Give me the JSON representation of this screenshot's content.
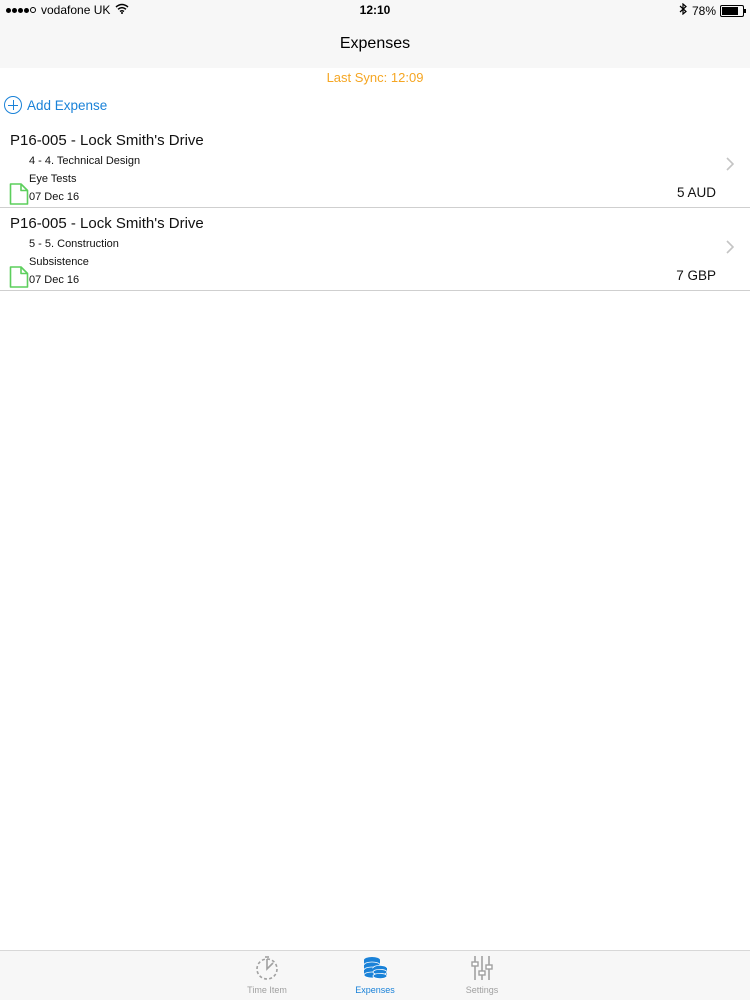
{
  "status_bar": {
    "carrier": "vodafone UK",
    "time": "12:10",
    "battery": "78%",
    "battery_level": 0.78
  },
  "nav": {
    "title": "Expenses"
  },
  "sync": {
    "text": "Last Sync: 12:09"
  },
  "add_expense": {
    "label": "Add Expense"
  },
  "expenses": [
    {
      "title": "P16-005 - Lock Smith's Drive",
      "stage": "4 - 4. Technical Design",
      "category": "Eye Tests",
      "date": "07 Dec 16",
      "amount": "5 AUD"
    },
    {
      "title": "P16-005 - Lock Smith's Drive",
      "stage": "5 - 5. Construction",
      "category": "Subsistence",
      "date": "07 Dec 16",
      "amount": "7 GBP"
    }
  ],
  "tab_bar": {
    "tabs": [
      {
        "label": "Time Item",
        "icon": "stopwatch-icon",
        "active": false
      },
      {
        "label": "Expenses",
        "icon": "coins-icon",
        "active": true
      },
      {
        "label": "Settings",
        "icon": "sliders-icon",
        "active": false
      }
    ]
  },
  "colors": {
    "accent": "#1a82d8",
    "sync": "#f5a623",
    "document_icon": "#5ccf5c"
  }
}
